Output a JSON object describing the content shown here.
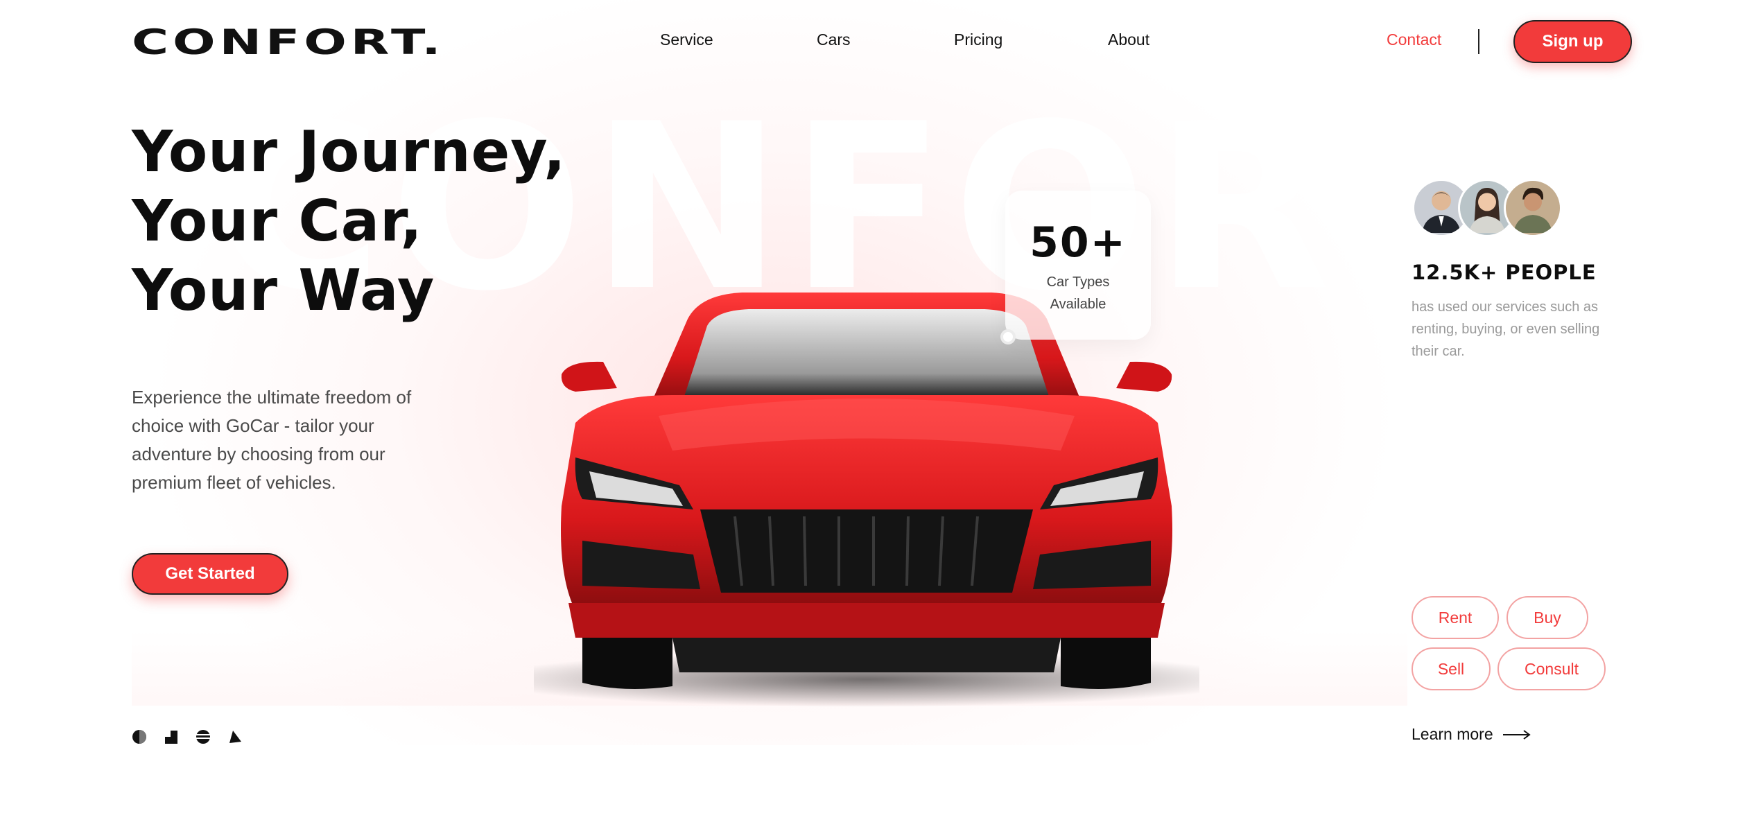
{
  "brand": {
    "logo": "CONFORT.",
    "background_word": "CONFORT"
  },
  "nav": {
    "links": [
      {
        "label": "Service"
      },
      {
        "label": "Cars"
      },
      {
        "label": "Pricing"
      },
      {
        "label": "About"
      }
    ],
    "contact": "Contact",
    "signup": "Sign up"
  },
  "hero": {
    "headline": [
      "Your Journey,",
      "Your Car,",
      "Your Way"
    ],
    "description": "Experience the ultimate freedom of choice with GoCar - tailor your adventure by choosing from our premium fleet of vehicles.",
    "cta": "Get Started"
  },
  "stats": {
    "number": "50+",
    "label_line1": "Car Types",
    "label_line2": "Available"
  },
  "people": {
    "count": "12.5K+ PEOPLE",
    "description": "has used our services such as renting, buying, or even selling their car."
  },
  "services": {
    "rent": "Rent",
    "buy": "Buy",
    "sell": "Sell",
    "consult": "Consult"
  },
  "learn_more": "Learn more",
  "colors": {
    "accent": "#f23b3b",
    "text": "#0d0d0d",
    "muted": "#9a9a9a",
    "car_red": "#d8181b"
  },
  "icons": [
    "circle-half-icon",
    "steps-icon",
    "stripe-globe-icon",
    "leaf-mark-icon"
  ]
}
